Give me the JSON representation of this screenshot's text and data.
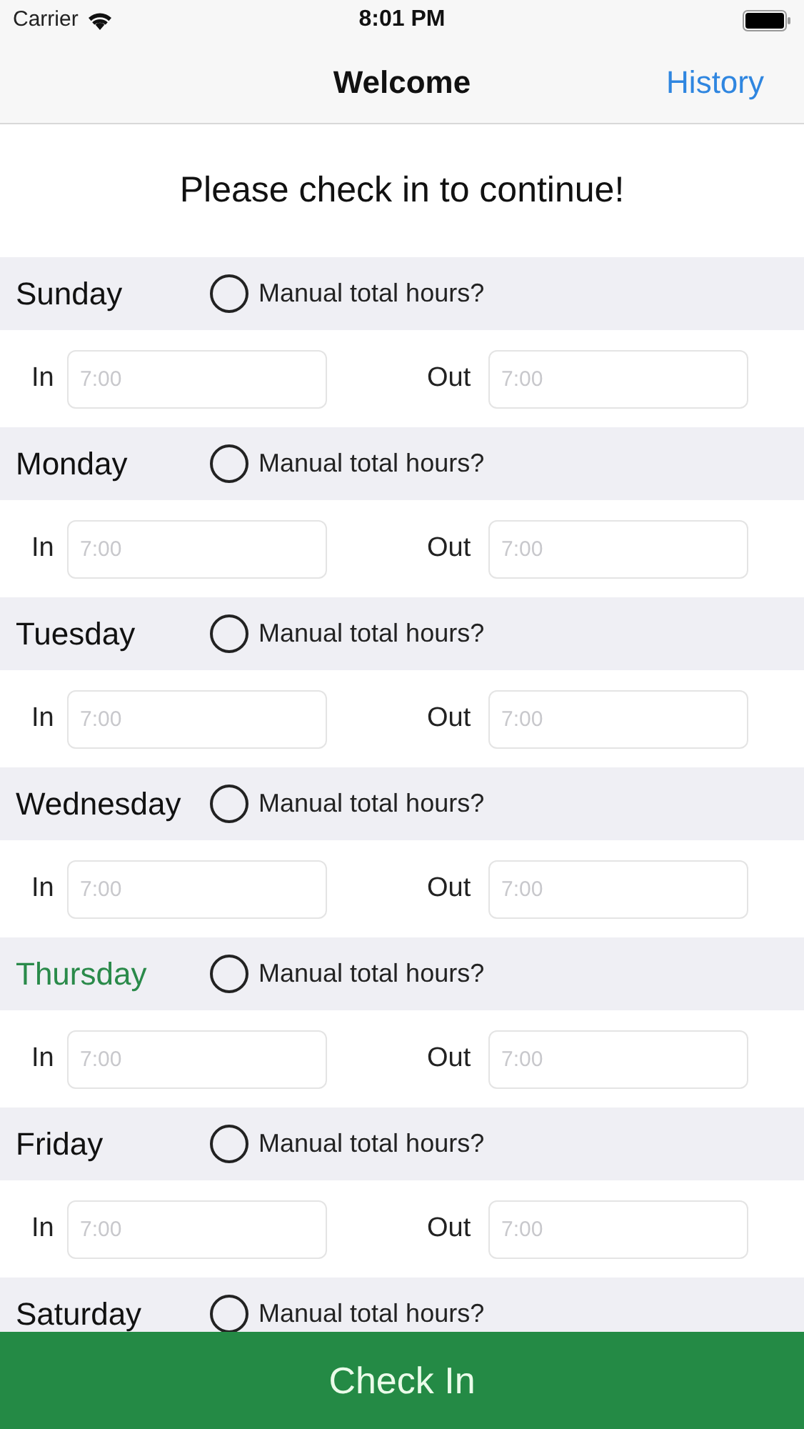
{
  "status_bar": {
    "carrier": "Carrier",
    "time": "8:01 PM"
  },
  "nav": {
    "title": "Welcome",
    "right_button": "History"
  },
  "prompt": "Please check in to continue!",
  "days": [
    {
      "name": "Sunday",
      "selected": false,
      "manual_label": "Manual total hours?",
      "manual_checked": false,
      "in_label": "In",
      "in_placeholder": "7:00",
      "out_label": "Out",
      "out_placeholder": "7:00"
    },
    {
      "name": "Monday",
      "selected": false,
      "manual_label": "Manual total hours?",
      "manual_checked": false,
      "in_label": "In",
      "in_placeholder": "7:00",
      "out_label": "Out",
      "out_placeholder": "7:00"
    },
    {
      "name": "Tuesday",
      "selected": false,
      "manual_label": "Manual total hours?",
      "manual_checked": false,
      "in_label": "In",
      "in_placeholder": "7:00",
      "out_label": "Out",
      "out_placeholder": "7:00"
    },
    {
      "name": "Wednesday",
      "selected": false,
      "manual_label": "Manual total hours?",
      "manual_checked": false,
      "in_label": "In",
      "in_placeholder": "7:00",
      "out_label": "Out",
      "out_placeholder": "7:00"
    },
    {
      "name": "Thursday",
      "selected": true,
      "manual_label": "Manual total hours?",
      "manual_checked": false,
      "in_label": "In",
      "in_placeholder": "7:00",
      "out_label": "Out",
      "out_placeholder": "7:00"
    },
    {
      "name": "Friday",
      "selected": false,
      "manual_label": "Manual total hours?",
      "manual_checked": false,
      "in_label": "In",
      "in_placeholder": "7:00",
      "out_label": "Out",
      "out_placeholder": "7:00"
    },
    {
      "name": "Saturday",
      "selected": false,
      "manual_label": "Manual total hours?",
      "manual_checked": false
    }
  ],
  "primary_button": "Check In"
}
